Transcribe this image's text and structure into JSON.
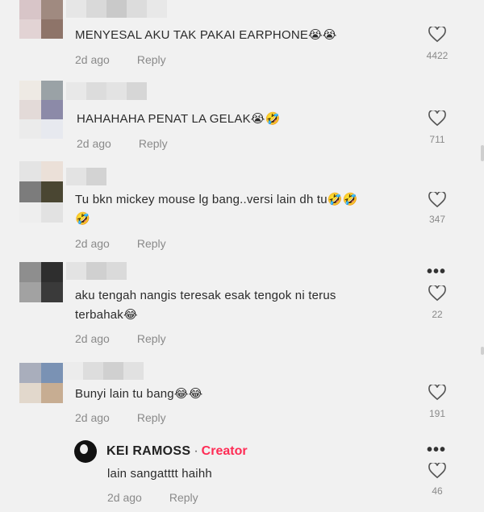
{
  "comments": [
    {
      "text": "MENYESAL AKU TAK PAKAI EARPHONE",
      "emoji": "😭😭",
      "time": "2d ago",
      "reply": "Reply",
      "likes": "4422"
    },
    {
      "text": "HAHAHAHA PENAT LA GELAK",
      "emoji": "😭🤣",
      "time": "2d ago",
      "reply": "Reply",
      "likes": "711"
    },
    {
      "text_line1": "Tu bkn mickey mouse lg bang..versi lain dh tu",
      "emoji_line1": "🤣🤣",
      "emoji_line2": "🤣",
      "time": "2d ago",
      "reply": "Reply",
      "likes": "347"
    },
    {
      "text_line1": "aku tengah nangis teresak esak tengok ni terus",
      "text_line2": "terbahak",
      "emoji": "😂",
      "time": "2d ago",
      "reply": "Reply",
      "likes": "22"
    },
    {
      "text": "Bunyi lain tu bang",
      "emoji": "😂😂",
      "time": "2d ago",
      "reply": "Reply",
      "likes": "191"
    }
  ],
  "creator_reply": {
    "name": "KEI RAMOSS",
    "separator": "·",
    "tag": "Creator",
    "text": "lain sangatttt haihh",
    "time": "2d ago",
    "reply": "Reply",
    "likes": "46"
  },
  "icons": {
    "like": "heart-outline-icon",
    "more": "more-dots-icon"
  },
  "colors": {
    "creator_tag": "#fe2c55",
    "muted": "#8a8a8a",
    "background": "#f1f1f1"
  }
}
